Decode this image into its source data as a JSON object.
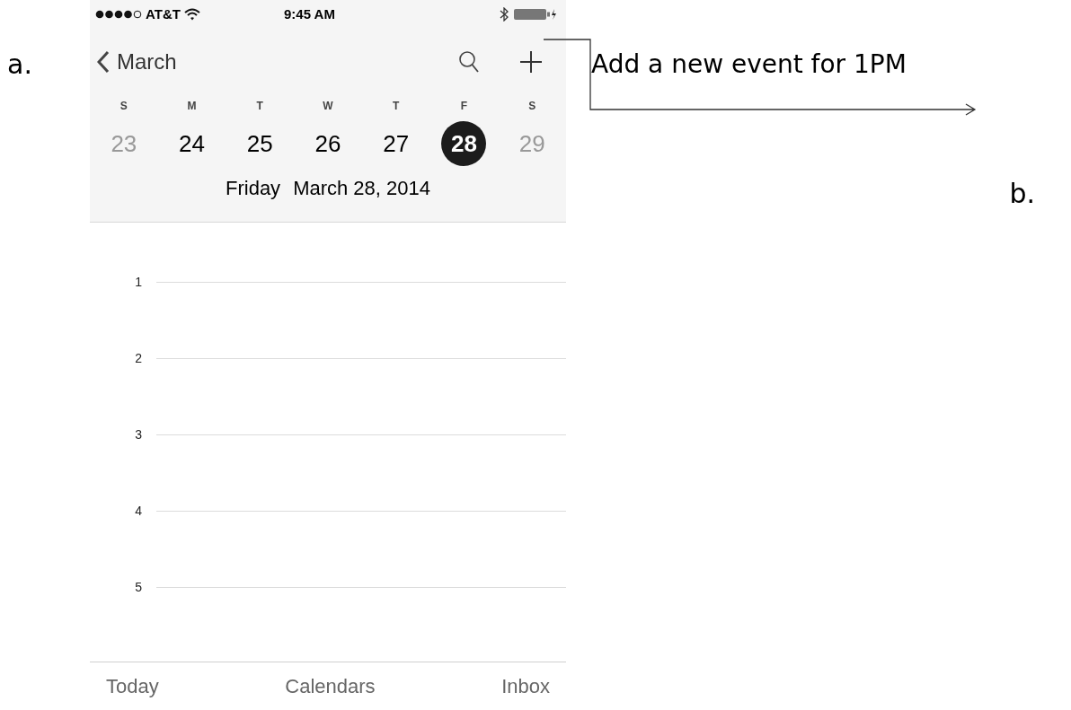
{
  "labels": {
    "a": "a.",
    "b": "b."
  },
  "callout": "Add a new event for 1PM",
  "status_bar": {
    "carrier": "AT&T",
    "time": "9:45 AM"
  },
  "nav": {
    "back": "March"
  },
  "week": [
    {
      "letter": "S",
      "date": "23",
      "weekend": true,
      "selected": false
    },
    {
      "letter": "M",
      "date": "24",
      "weekend": false,
      "selected": false
    },
    {
      "letter": "T",
      "date": "25",
      "weekend": false,
      "selected": false
    },
    {
      "letter": "W",
      "date": "26",
      "weekend": false,
      "selected": false
    },
    {
      "letter": "T",
      "date": "27",
      "weekend": false,
      "selected": false
    },
    {
      "letter": "F",
      "date": "28",
      "weekend": false,
      "selected": true
    },
    {
      "letter": "S",
      "date": "29",
      "weekend": true,
      "selected": false
    }
  ],
  "date_title": {
    "weekday": "Friday",
    "date": "March 28, 2014"
  },
  "hours": [
    "1",
    "2",
    "3",
    "4",
    "5"
  ],
  "tab_bar": [
    "Today",
    "Calendars",
    "Inbox"
  ]
}
